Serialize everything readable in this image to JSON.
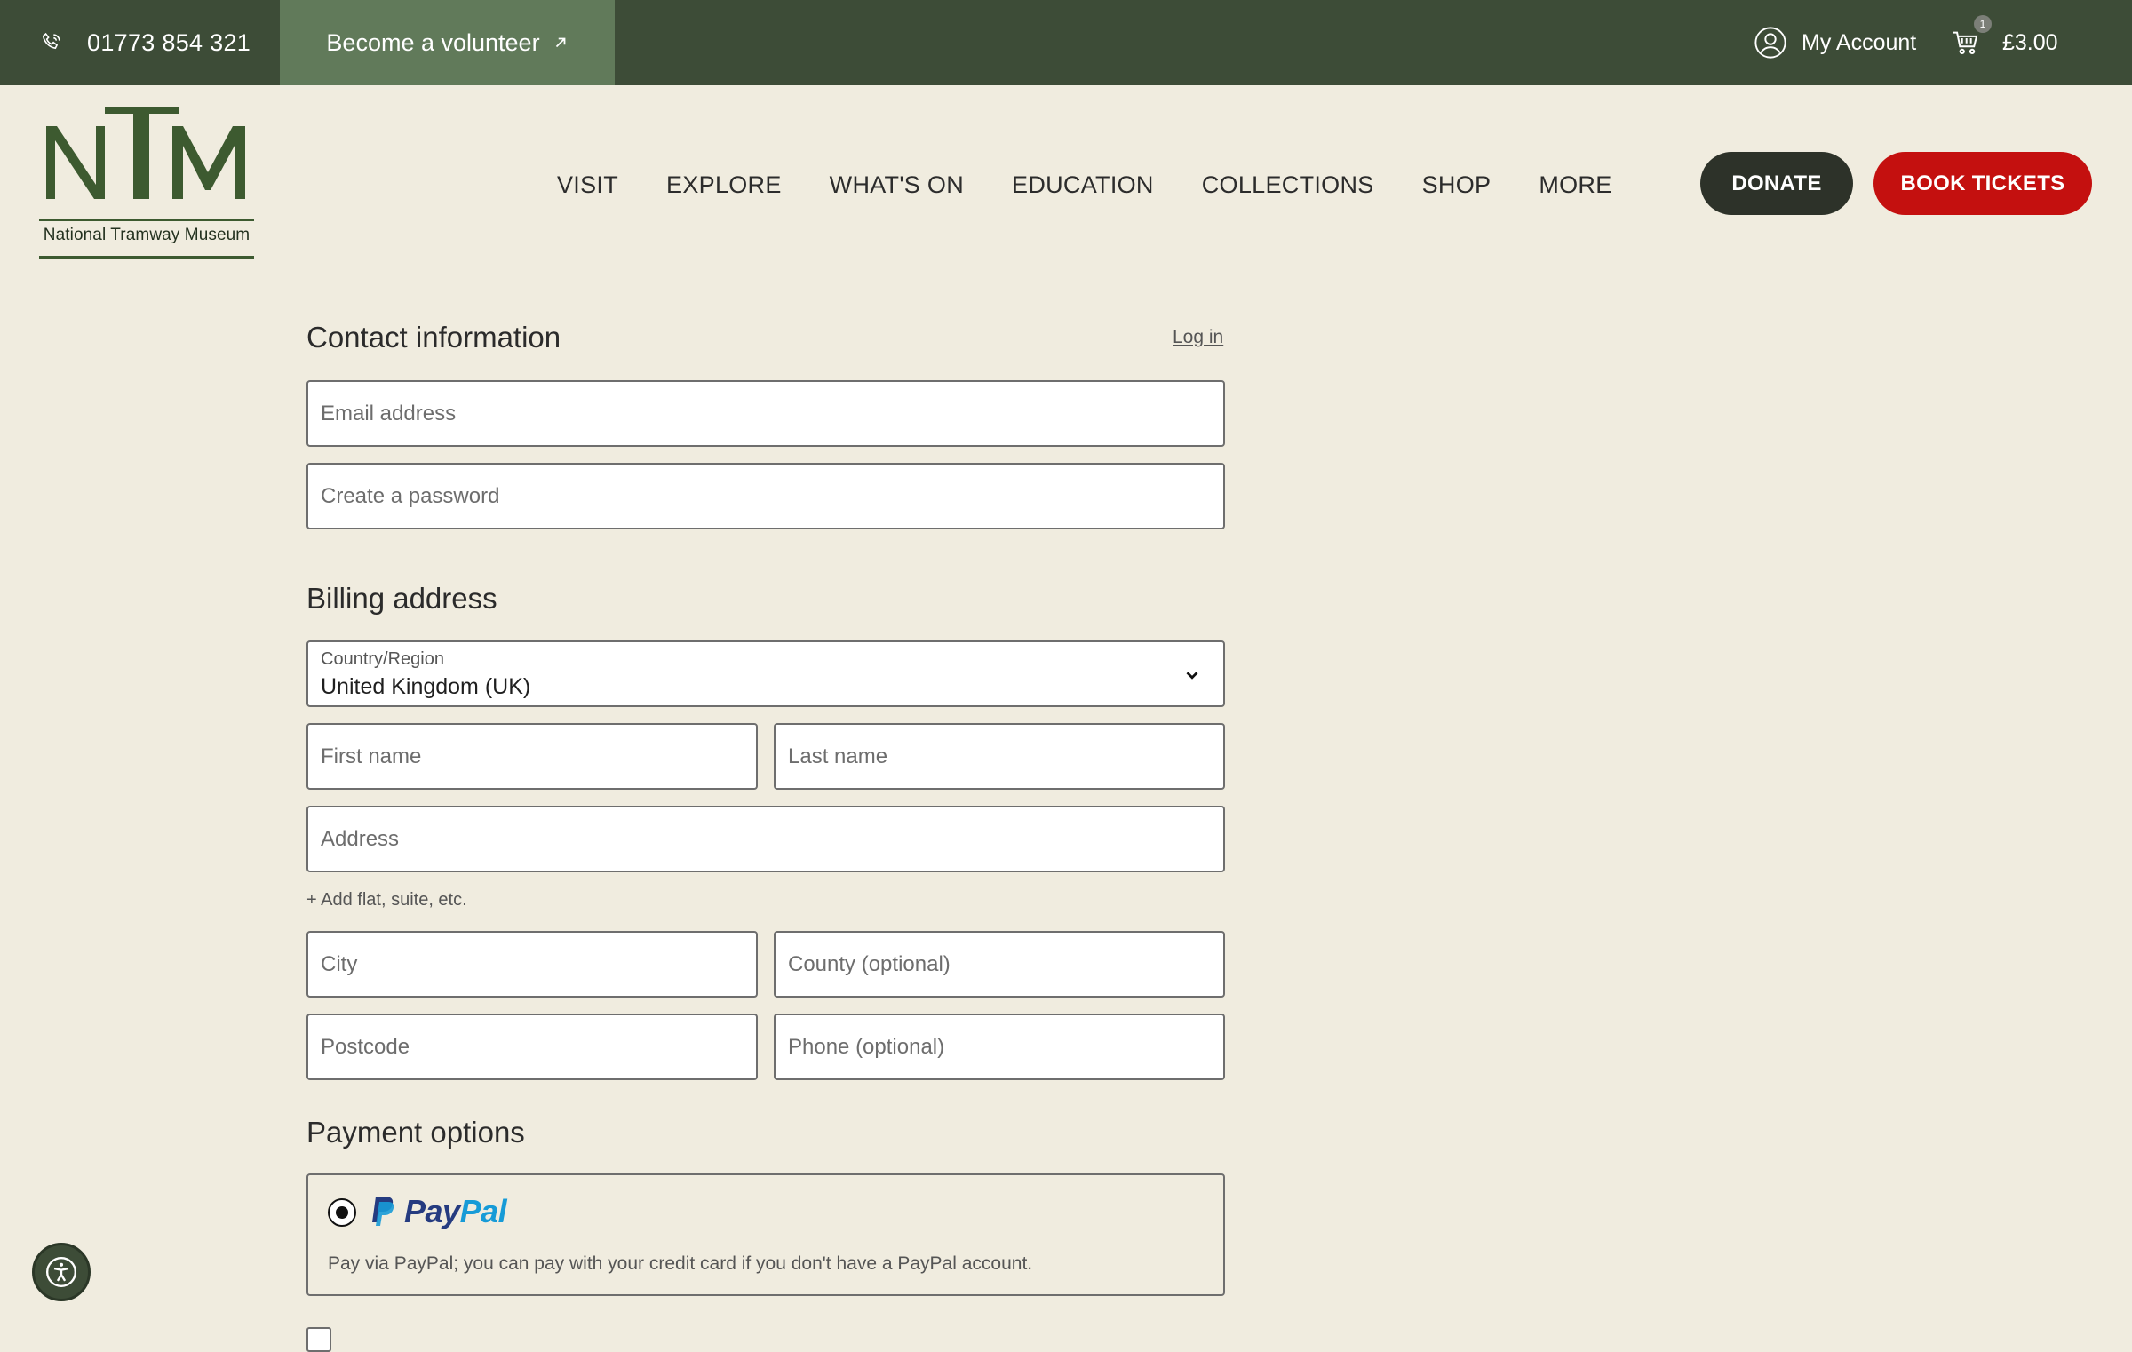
{
  "topbar": {
    "phone": "01773 854 321",
    "volunteer": "Become a volunteer",
    "account": "My Account",
    "cart_count": "1",
    "cart_total": "£3.00"
  },
  "logo": {
    "caption": "National Tramway Museum"
  },
  "nav": [
    "VISIT",
    "EXPLORE",
    "WHAT'S ON",
    "EDUCATION",
    "COLLECTIONS",
    "SHOP",
    "MORE"
  ],
  "buttons": {
    "donate": "DONATE",
    "book": "BOOK TICKETS"
  },
  "contact": {
    "title": "Contact information",
    "login": "Log in",
    "email_placeholder": "Email address",
    "password_placeholder": "Create a password"
  },
  "billing": {
    "title": "Billing address",
    "country_label": "Country/Region",
    "country_value": "United Kingdom (UK)",
    "first_name": "First name",
    "last_name": "Last name",
    "address": "Address",
    "add_line": "+ Add flat, suite, etc.",
    "city": "City",
    "county": "County (optional)",
    "postcode": "Postcode",
    "phone": "Phone (optional)"
  },
  "payment": {
    "title": "Payment options",
    "paypal_pay": "Pay",
    "paypal_pal": "Pal",
    "paypal_desc": "Pay via PayPal; you can pay with your credit card if you don't have a PayPal account."
  },
  "colors": {
    "topbar": "#3d4c37",
    "volunteer": "#617a5a",
    "background": "#f0ecdf",
    "donate": "#2d3229",
    "book": "#c4100f"
  }
}
